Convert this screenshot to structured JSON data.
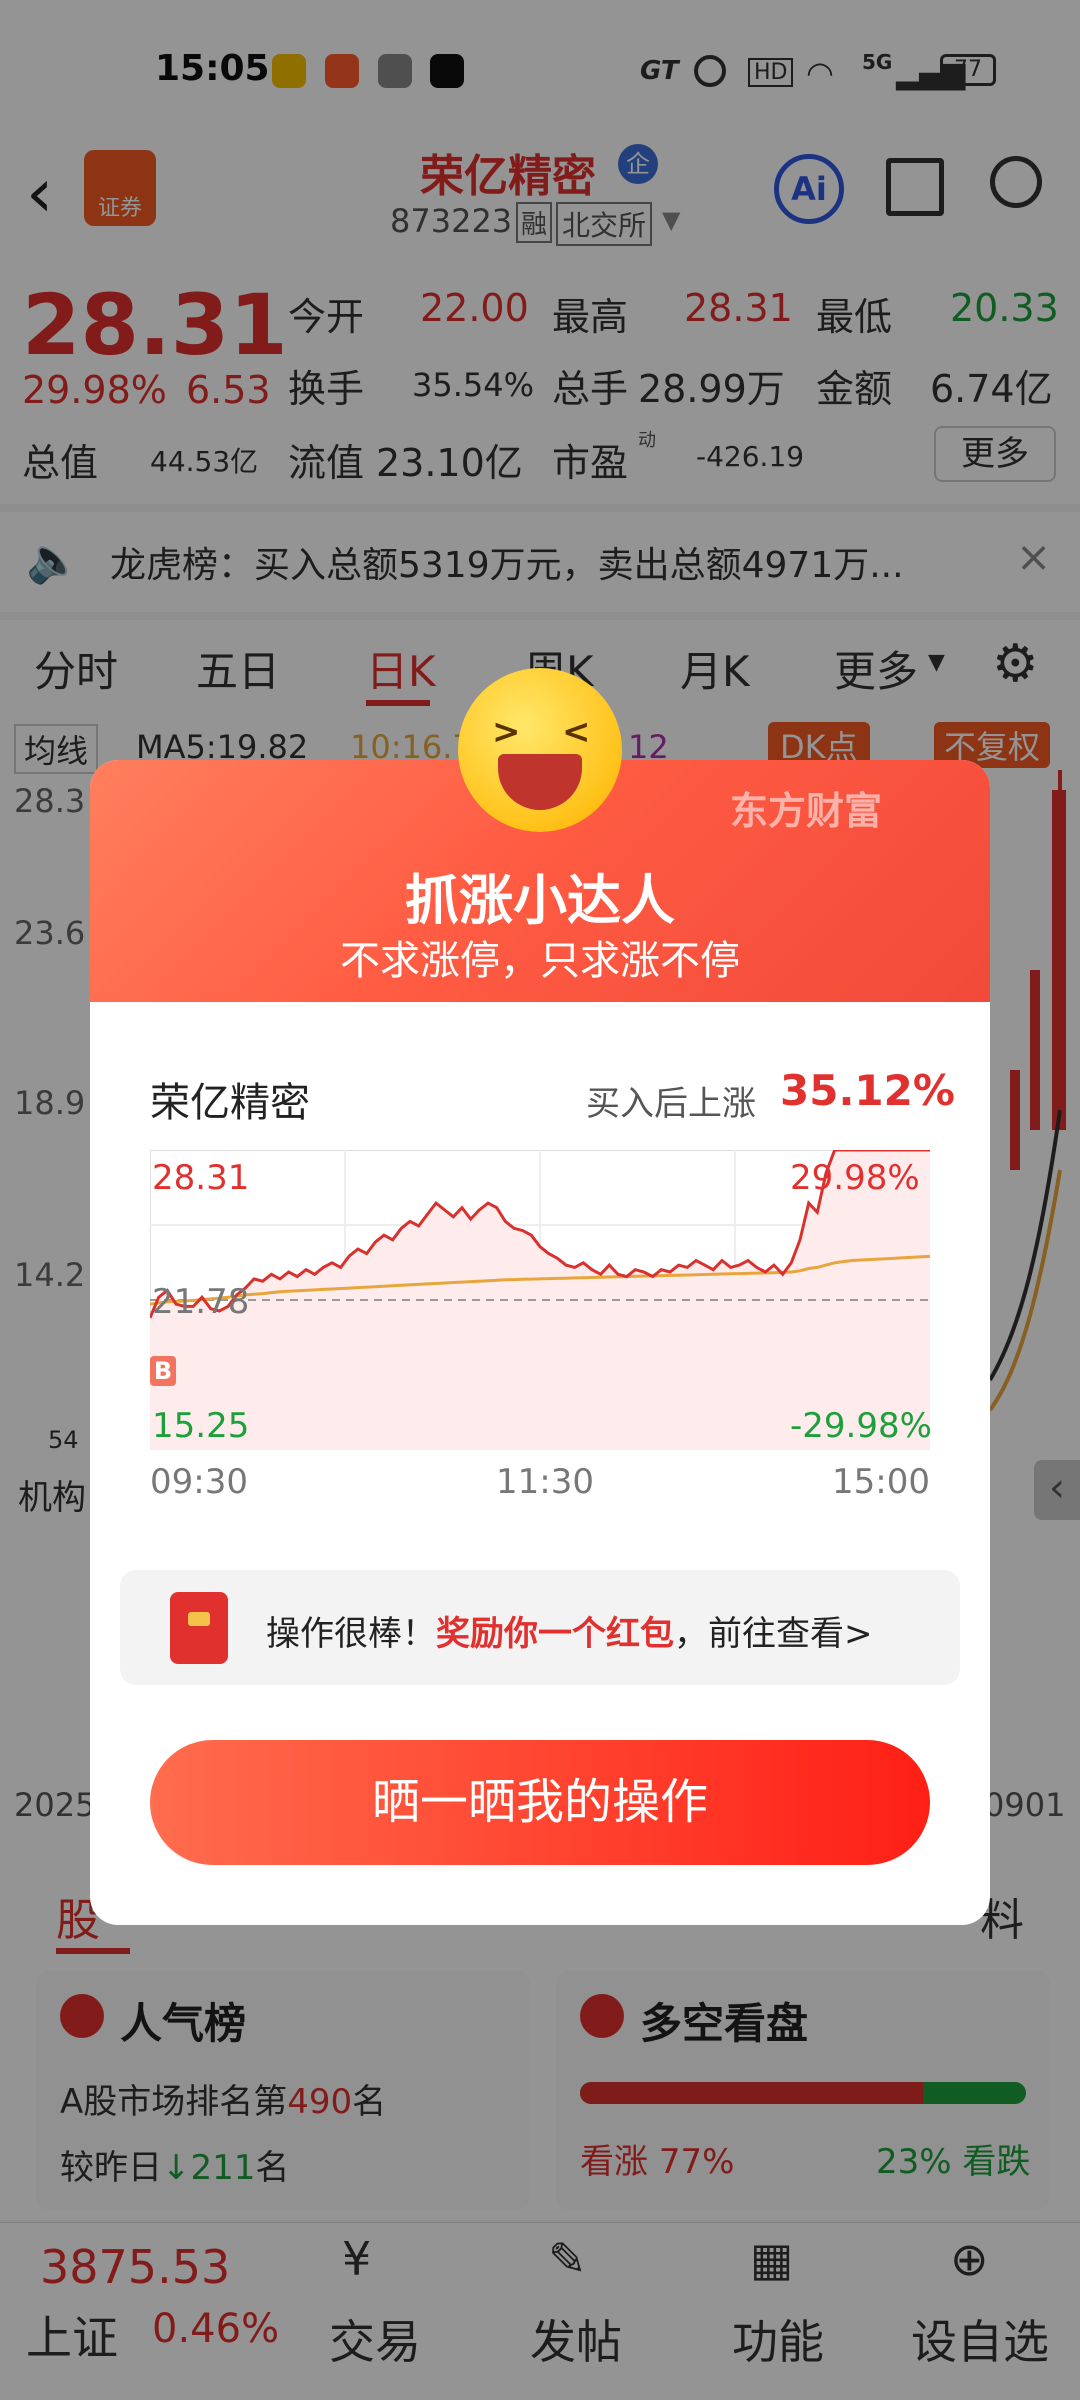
{
  "status_bar": {
    "time": "15:05",
    "battery": "77",
    "network": "5G"
  },
  "header": {
    "stock_name": "荣亿精密",
    "badge": "企",
    "code": "873223",
    "margin_tag": "融",
    "exchange": "北交所",
    "broker_label": "证券",
    "ai_label": "Ai"
  },
  "quote": {
    "price": "28.31",
    "change_pct": "29.98%",
    "change_amt": "6.53",
    "open_label": "今开",
    "open": "22.00",
    "high_label": "最高",
    "high": "28.31",
    "low_label": "最低",
    "low": "20.33",
    "turnover_label": "换手",
    "turnover": "35.54%",
    "volume_label": "总手",
    "volume": "28.99万",
    "amount_label": "金额",
    "amount": "6.74亿",
    "mcap_label": "总值",
    "mcap": "44.53亿",
    "float_label": "流值",
    "float_cap": "23.10亿",
    "pe_label": "市盈",
    "pe_sup": "动",
    "pe": "-426.19",
    "more_label": "更多"
  },
  "banner": {
    "text": "龙虎榜：买入总额5319万元，卖出总额4971万..."
  },
  "kline_tabs": {
    "items": [
      "分时",
      "五日",
      "日K",
      "周K",
      "月K",
      "更多"
    ],
    "active": "日K"
  },
  "ma_bar": {
    "selector": "均线",
    "ma5": "MA5:19.82",
    "ma10": "10:16.7",
    "ma20": "12",
    "dk": "DK点",
    "fq": "不复权"
  },
  "kline_axis": {
    "y_labels": [
      "28.3",
      "23.6",
      "18.9",
      "14.2"
    ],
    "date_left": "2025",
    "date_right": "0901",
    "small_label": "54",
    "inst_label": "机构"
  },
  "lower": {
    "tabs": [
      "股",
      "料"
    ],
    "popularity": {
      "title": "人气榜",
      "rank_prefix": "A股市场排名第",
      "rank": "490",
      "rank_suffix": "名",
      "change_prefix": "较昨日",
      "change": "211",
      "change_suffix": "名"
    },
    "longshort": {
      "title": "多空看盘",
      "bull_label": "看涨",
      "bull": "77%",
      "bear": "23%",
      "bear_label": "看跌",
      "bull_fraction": 0.77
    }
  },
  "bottom_nav": {
    "index_value": "3875.53",
    "index_name": "上证",
    "index_change": "0.46%",
    "items": [
      "交易",
      "发帖",
      "功能",
      "设自选"
    ]
  },
  "modal": {
    "brand": "东方财富",
    "title": "抓涨小达人",
    "subtitle": "不求涨停，只求涨不停",
    "stock_name": "荣亿精密",
    "gain_label": "买入后上涨",
    "gain": "35.12%",
    "chart_marker": "B",
    "reward_prefix": "操作很棒！",
    "reward_highlight": "奖励你一个红包",
    "reward_suffix": "，前往查看>",
    "share_button": "晒一晒我的操作"
  },
  "chart_data": {
    "type": "line",
    "title": "",
    "xlabel": "",
    "ylabel": "",
    "y_top_label": "28.31",
    "y_mid_label": "21.78",
    "y_bottom_label": "15.25",
    "pct_top_label": "29.98%",
    "pct_bottom_label": "-29.98%",
    "x_tick_labels": [
      "09:30",
      "11:30",
      "15:00"
    ],
    "ylim": [
      15.25,
      28.31
    ],
    "reference": 21.78,
    "series": [
      {
        "values": [
          21.0,
          21.9,
          22.2,
          21.6,
          21.5,
          21.5,
          21.9,
          21.4,
          21.3,
          21.5,
          22.0,
          22.3,
          22.7,
          22.6,
          22.9,
          22.7,
          23.0,
          22.8,
          23.1,
          22.9,
          23.2,
          23.4,
          23.2,
          23.7,
          24.0,
          23.8,
          24.3,
          24.6,
          24.4,
          24.9,
          25.2,
          25.0,
          25.5,
          26.0,
          25.7,
          25.4,
          25.8,
          25.3,
          25.7,
          26.0,
          25.8,
          25.2,
          24.9,
          24.8,
          24.6,
          24.1,
          23.8,
          23.6,
          23.3,
          23.2,
          23.4,
          23.1,
          22.9,
          23.3,
          22.9,
          22.8,
          23.1,
          23.0,
          22.8,
          23.1,
          23.0,
          23.3,
          23.2,
          23.5,
          23.3,
          23.1,
          23.5,
          23.2,
          23.3,
          23.5,
          23.2,
          23.0,
          23.3,
          22.9,
          23.4,
          24.4,
          26.0,
          25.6,
          27.3,
          28.31,
          28.31,
          28.31,
          28.31,
          28.31,
          28.31,
          28.31,
          28.31,
          28.31,
          28.31,
          28.31,
          28.31
        ]
      },
      {
        "values": [
          21.6,
          21.65,
          21.7,
          21.72,
          21.74,
          21.76,
          21.8,
          21.83,
          21.86,
          21.9,
          21.95,
          22.0,
          22.03,
          22.06,
          22.1,
          22.14,
          22.16,
          22.18,
          22.2,
          22.22,
          22.24,
          22.26,
          22.28,
          22.3,
          22.32,
          22.34,
          22.36,
          22.38,
          22.4,
          22.42,
          22.44,
          22.46,
          22.48,
          22.5,
          22.52,
          22.54,
          22.56,
          22.58,
          22.6,
          22.62,
          22.64,
          22.66,
          22.67,
          22.68,
          22.69,
          22.7,
          22.71,
          22.72,
          22.73,
          22.74,
          22.75,
          22.76,
          22.77,
          22.78,
          22.79,
          22.8,
          22.81,
          22.82,
          22.83,
          22.84,
          22.85,
          22.86,
          22.87,
          22.88,
          22.89,
          22.9,
          22.91,
          22.92,
          22.93,
          22.94,
          22.95,
          22.96,
          22.97,
          22.98,
          23.0,
          23.05,
          23.15,
          23.2,
          23.3,
          23.4,
          23.45,
          23.5,
          23.52,
          23.54,
          23.56,
          23.58,
          23.6,
          23.62,
          23.64,
          23.66,
          23.68
        ]
      }
    ],
    "colors": {
      "price": "#d9312d",
      "avg": "#e8a53b",
      "fill": "#fdeceb",
      "ref": "#999999"
    },
    "grid": true
  }
}
